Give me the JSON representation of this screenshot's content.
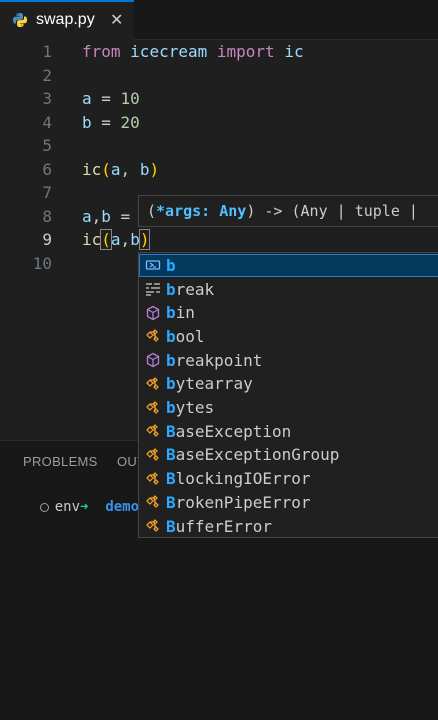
{
  "tab": {
    "filename": "swap.py",
    "close_glyph": "✕",
    "icon": "python-icon"
  },
  "editor": {
    "active_line": 9,
    "lines": [
      {
        "n": "1",
        "tokens": [
          [
            "kw",
            "from"
          ],
          [
            "pl",
            " "
          ],
          [
            "id",
            "icecream"
          ],
          [
            "pl",
            " "
          ],
          [
            "kw",
            "import"
          ],
          [
            "pl",
            " "
          ],
          [
            "id",
            "ic"
          ]
        ]
      },
      {
        "n": "2",
        "tokens": []
      },
      {
        "n": "3",
        "tokens": [
          [
            "id",
            "a"
          ],
          [
            "pl",
            " = "
          ],
          [
            "num",
            "10"
          ]
        ]
      },
      {
        "n": "4",
        "tokens": [
          [
            "id",
            "b"
          ],
          [
            "pl",
            " = "
          ],
          [
            "num",
            "20"
          ]
        ]
      },
      {
        "n": "5",
        "tokens": []
      },
      {
        "n": "6",
        "tokens": [
          [
            "fn",
            "ic"
          ],
          [
            "br1",
            "("
          ],
          [
            "id",
            "a"
          ],
          [
            "pl",
            ", "
          ],
          [
            "id",
            "b"
          ],
          [
            "br1",
            ")"
          ]
        ]
      },
      {
        "n": "7",
        "tokens": []
      },
      {
        "n": "8",
        "tokens": [
          [
            "id",
            "a"
          ],
          [
            "pl",
            ","
          ],
          [
            "id",
            "b"
          ],
          [
            "pl",
            " ="
          ]
        ]
      },
      {
        "n": "9",
        "tokens": [
          [
            "fn",
            "ic"
          ],
          [
            "br1",
            "("
          ],
          [
            "id",
            "a"
          ],
          [
            "pl",
            ","
          ],
          [
            "id",
            "b"
          ],
          [
            "br1",
            ")"
          ]
        ]
      },
      {
        "n": "10",
        "tokens": []
      }
    ]
  },
  "signature_hint": {
    "open": "(",
    "param": "*args: Any",
    "rest": ") -> (Any | tuple |"
  },
  "suggestions": {
    "selected_index": 0,
    "items": [
      {
        "match": "b",
        "rest": "",
        "kind": "variable-icon",
        "color": "#75beff"
      },
      {
        "match": "b",
        "rest": "reak",
        "kind": "keyword-icon",
        "color": "#cccccc"
      },
      {
        "match": "b",
        "rest": "in",
        "kind": "module-icon",
        "color": "#b180d7"
      },
      {
        "match": "b",
        "rest": "ool",
        "kind": "class-icon",
        "color": "#ee9d28"
      },
      {
        "match": "b",
        "rest": "reakpoint",
        "kind": "function-icon",
        "color": "#b180d7"
      },
      {
        "match": "b",
        "rest": "ytearray",
        "kind": "class-icon",
        "color": "#ee9d28"
      },
      {
        "match": "b",
        "rest": "ytes",
        "kind": "class-icon",
        "color": "#ee9d28"
      },
      {
        "match": "B",
        "rest": "aseException",
        "kind": "class-icon",
        "color": "#ee9d28"
      },
      {
        "match": "B",
        "rest": "aseExceptionGroup",
        "kind": "class-icon",
        "color": "#ee9d28"
      },
      {
        "match": "B",
        "rest": "lockingIOError",
        "kind": "class-icon",
        "color": "#ee9d28"
      },
      {
        "match": "B",
        "rest": "rokenPipeError",
        "kind": "class-icon",
        "color": "#ee9d28"
      },
      {
        "match": "B",
        "rest": "ufferError",
        "kind": "class-icon",
        "color": "#ee9d28"
      }
    ]
  },
  "panel": {
    "tabs": [
      "PROBLEMS",
      "OUT"
    ],
    "terminal": {
      "env": "env",
      "arrow": "➜",
      "dir": "demo git:"
    }
  },
  "colors": {
    "accent": "#0078d4",
    "selection": "#04395e",
    "match": "#2aaaff"
  }
}
